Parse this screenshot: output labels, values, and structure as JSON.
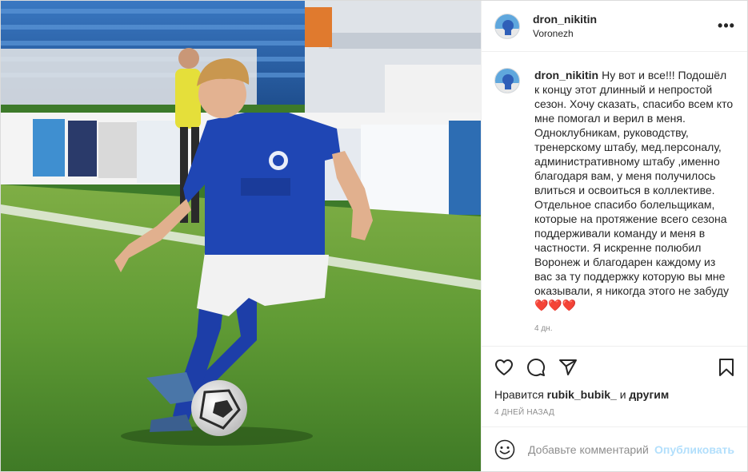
{
  "post": {
    "author": {
      "username": "dron_nikitin",
      "location": "Voronezh"
    },
    "menu_icon": "more-horizontal-icon",
    "caption": {
      "username": "dron_nikitin",
      "text": "Ну вот и все!!! Подошёл к концу этот длинный и непростой сезон. Хочу сказать, спасибо всем кто мне помогал и верил в меня. Одноклубникам, руководству, тренерскому штабу, мед.персоналу, административному штабу ,именно благодаря вам, у меня получилось влиться и освоиться в коллективе. Отдельное спасибо болельщикам, которые на протяжение всего сезона поддерживали команду и меня в частности. Я искренне полюбил Воронеж и благодарен каждому из вас за ту поддержку которую вы мне оказывали, я никогда этого не забуду",
      "hearts": "❤️❤️❤️",
      "time": "4 дн."
    },
    "actions": {
      "like_icon": "heart-icon",
      "comment_icon": "comment-icon",
      "share_icon": "share-icon",
      "save_icon": "bookmark-icon"
    },
    "likes": {
      "prefix": "Нравится",
      "user": "rubik_bubik_",
      "middle": "и",
      "others": "другим"
    },
    "date": "4 ДНЕЙ НАЗАД",
    "comment_box": {
      "emoji_icon": "smiley-icon",
      "placeholder": "Добавьте комментарий...",
      "publish_label": "Опубликовать"
    }
  },
  "colors": {
    "text": "#262626",
    "muted": "#8e8e8e",
    "border": "#dbdbdb",
    "publish_disabled": "#b2dffc",
    "heart": "#ed4956"
  }
}
